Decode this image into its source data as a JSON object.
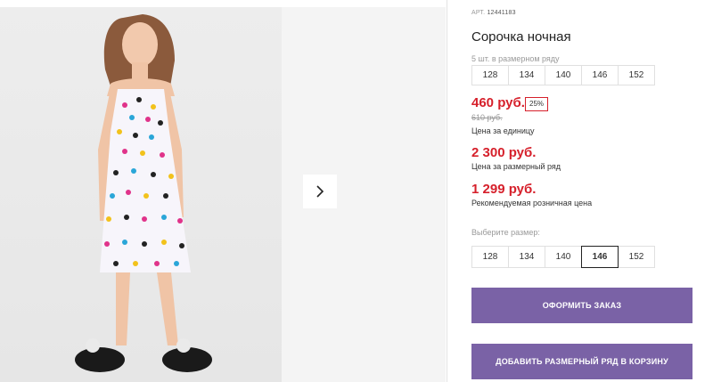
{
  "product": {
    "article_label": "АРТ.",
    "article_number": "12441183",
    "title": "Сорочка ночная",
    "pack_note": "5 шт. в размерном ряду",
    "pack_sizes": [
      "128",
      "134",
      "140",
      "146",
      "152"
    ],
    "price_unit": "460 руб.",
    "discount": "25%",
    "old_price": "610 руб.",
    "price_unit_caption": "Цена за единицу",
    "price_pack": "2 300 руб.",
    "price_pack_caption": "Цена за размерный ряд",
    "price_rrp": "1 299 руб.",
    "price_rrp_caption": "Рекомендуемая розничная цена",
    "choose_size_label": "Выберите размер:",
    "sizes": [
      "128",
      "134",
      "140",
      "146",
      "152"
    ],
    "selected_size": "146"
  },
  "buttons": {
    "order": "ОФОРМИТЬ ЗАКАЗ",
    "add_pack": "ДОБАВИТЬ РАЗМЕРНЫЙ РЯД В КОРЗИНУ"
  },
  "gallery": {
    "next_icon": "chevron-right-icon"
  },
  "colors": {
    "accent_button": "#7a62a6",
    "price_red": "#d6202b"
  }
}
